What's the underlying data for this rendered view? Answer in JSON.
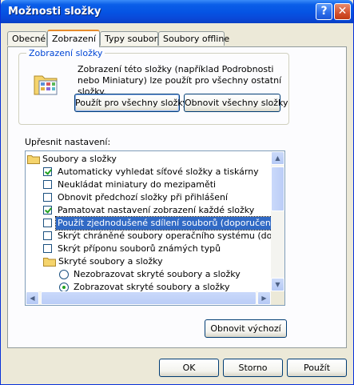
{
  "window": {
    "title": "Možnosti složky"
  },
  "titlebar": {
    "help_glyph": "?",
    "close_glyph": "✕"
  },
  "tabs": [
    {
      "label": "Obecné"
    },
    {
      "label": "Zobrazení"
    },
    {
      "label": "Typy souborů"
    },
    {
      "label": "Soubory offline"
    }
  ],
  "active_tab": "Zobrazení",
  "folder_views": {
    "title": "Zobrazení složky",
    "icon": "folder-view-icon",
    "description": "Zobrazení této složky (například Podrobnosti nebo Miniatury) lze použít pro všechny ostatní složky.",
    "apply_all_label": "Použít pro všechny složky",
    "reset_all_label": "Obnovit všechny složky"
  },
  "advanced": {
    "label": "Upřesnit nastavení:",
    "items": [
      {
        "type": "folder",
        "label": "Soubory a složky",
        "level": 0
      },
      {
        "type": "checkbox",
        "label": "Automaticky vyhledat síťové složky a tiskárny",
        "checked": true
      },
      {
        "type": "checkbox",
        "label": "Neukládat miniatury do mezipaměti",
        "checked": false
      },
      {
        "type": "checkbox",
        "label": "Obnovit předchozí složky při přihlášení",
        "checked": false
      },
      {
        "type": "checkbox",
        "label": "Pamatovat nastavení zobrazení každé složky",
        "checked": true
      },
      {
        "type": "checkbox",
        "label": "Použít zjednodušené sdílení souborů (doporučeno)",
        "checked": false,
        "selected": true
      },
      {
        "type": "checkbox",
        "label": "Skrýt chráněné soubory operačního systému (doporučer",
        "checked": false
      },
      {
        "type": "checkbox",
        "label": "Skrýt příponu souborů známých typů",
        "checked": false
      },
      {
        "type": "folder",
        "label": "Skryté soubory a složky",
        "level": 1
      },
      {
        "type": "radio",
        "label": "Nezobrazovat skryté soubory a složky",
        "checked": false
      },
      {
        "type": "radio",
        "label": "Zobrazovat skryté soubory a složky",
        "checked": true
      }
    ],
    "restore_label": "Obnovit výchozí"
  },
  "footer": {
    "ok_label": "OK",
    "cancel_label": "Storno",
    "apply_label": "Použít"
  },
  "colors": {
    "title_bar": "#0a5ee8",
    "selection": "#316ac5",
    "dialog_bg": "#ece9d8",
    "active_tab_accent": "#e68b2c",
    "group_title": "#0046d5"
  }
}
